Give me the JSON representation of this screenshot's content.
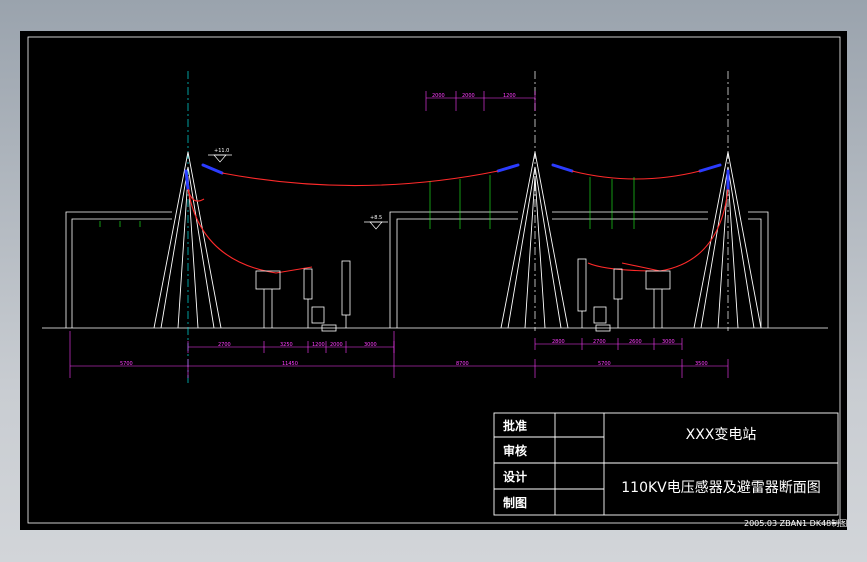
{
  "title_block": {
    "row_labels": [
      "批准",
      "审核",
      "设计",
      "制图"
    ],
    "station_name": "XXX变电站",
    "drawing_title": "110KV电压感器及避雷器断面图"
  },
  "footer": "2005.03  ZBAN1 DK48制图",
  "top_dimensions": [
    "2000",
    "2000",
    "1200"
  ],
  "level_marks": {
    "left": "+11.0",
    "right": "+8.5"
  },
  "lower_dimensions_left": [
    "2700",
    "3250",
    "1200",
    "2000",
    "3000"
  ],
  "lower_dimensions_right": [
    "2800",
    "2700",
    "2600",
    "3000"
  ],
  "overall_dimensions": [
    "5700",
    "11450",
    "8700",
    "5700",
    "3500"
  ],
  "colors": {
    "background": "#000000",
    "structure": "#ffffff",
    "conductor": "#ff2a2a",
    "dimension": "#ff3cff",
    "insulator": "#2b3cff",
    "centerline": "#00e0e0",
    "tap": "#22ff22"
  }
}
